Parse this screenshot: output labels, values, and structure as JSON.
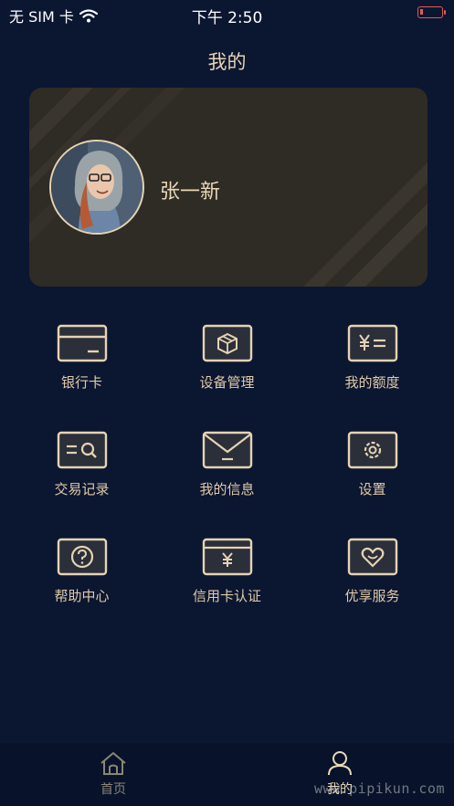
{
  "status_bar": {
    "carrier": "无 SIM 卡",
    "time": "下午 2:50"
  },
  "header": {
    "title": "我的"
  },
  "profile": {
    "name": "张一新"
  },
  "menu": {
    "items": [
      {
        "label": "银行卡",
        "icon": "bank-card-icon"
      },
      {
        "label": "设备管理",
        "icon": "device-box-icon"
      },
      {
        "label": "我的额度",
        "icon": "yen-equals-icon"
      },
      {
        "label": "交易记录",
        "icon": "search-record-icon"
      },
      {
        "label": "我的信息",
        "icon": "envelope-icon"
      },
      {
        "label": "设置",
        "icon": "gear-icon"
      },
      {
        "label": "帮助中心",
        "icon": "question-icon"
      },
      {
        "label": "信用卡认证",
        "icon": "yen-card-icon"
      },
      {
        "label": "优享服务",
        "icon": "heart-icon"
      }
    ]
  },
  "tab_bar": {
    "home_label": "首页",
    "mine_label": "我的",
    "active": "mine"
  },
  "watermark": "www.pipikun.com",
  "colors": {
    "background": "#0b1631",
    "accent_gold": "#e6d3b3",
    "card": "#2f2b25",
    "tab_bar": "#08122a"
  }
}
